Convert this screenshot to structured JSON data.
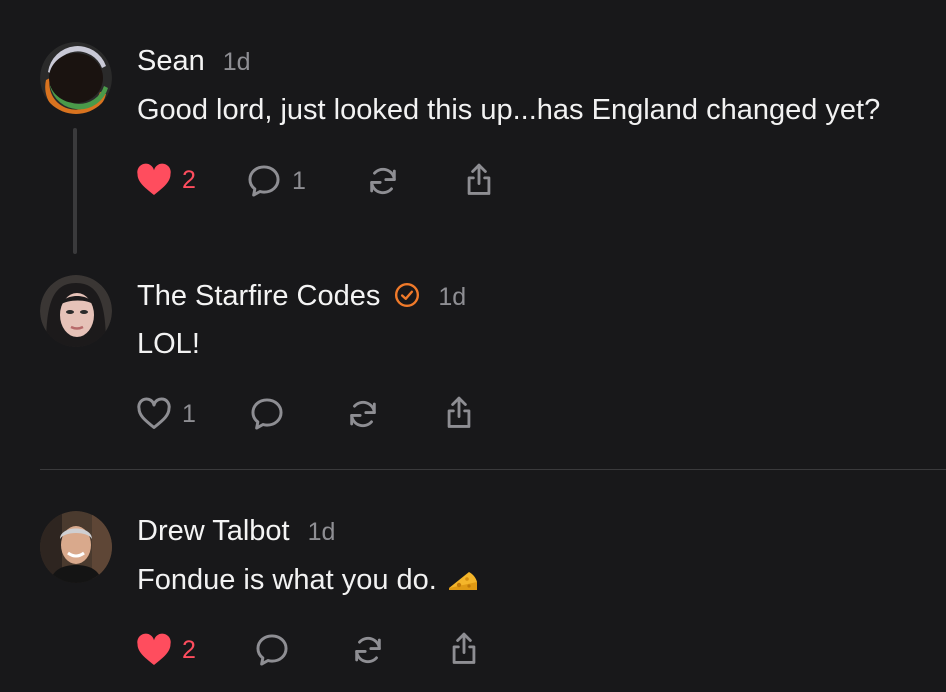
{
  "comments": [
    {
      "author": "Sean",
      "time": "1d",
      "text": "Good lord, just looked this up...has England changed yet?",
      "like_count": "2",
      "liked": true,
      "reply_count": "1"
    },
    {
      "author": "The Starfire Codes",
      "time": "1d",
      "verified": true,
      "text": "LOL!",
      "like_count": "1",
      "liked": false
    },
    {
      "author": "Drew Talbot",
      "time": "1d",
      "text": "Fondue is what you do.",
      "emoji": "cheese-icon",
      "like_count": "2",
      "liked": true
    }
  ],
  "colors": {
    "background": "#18181a",
    "like": "#ff4d5e",
    "muted": "#8e8e93",
    "verified": "#f07a2a"
  }
}
